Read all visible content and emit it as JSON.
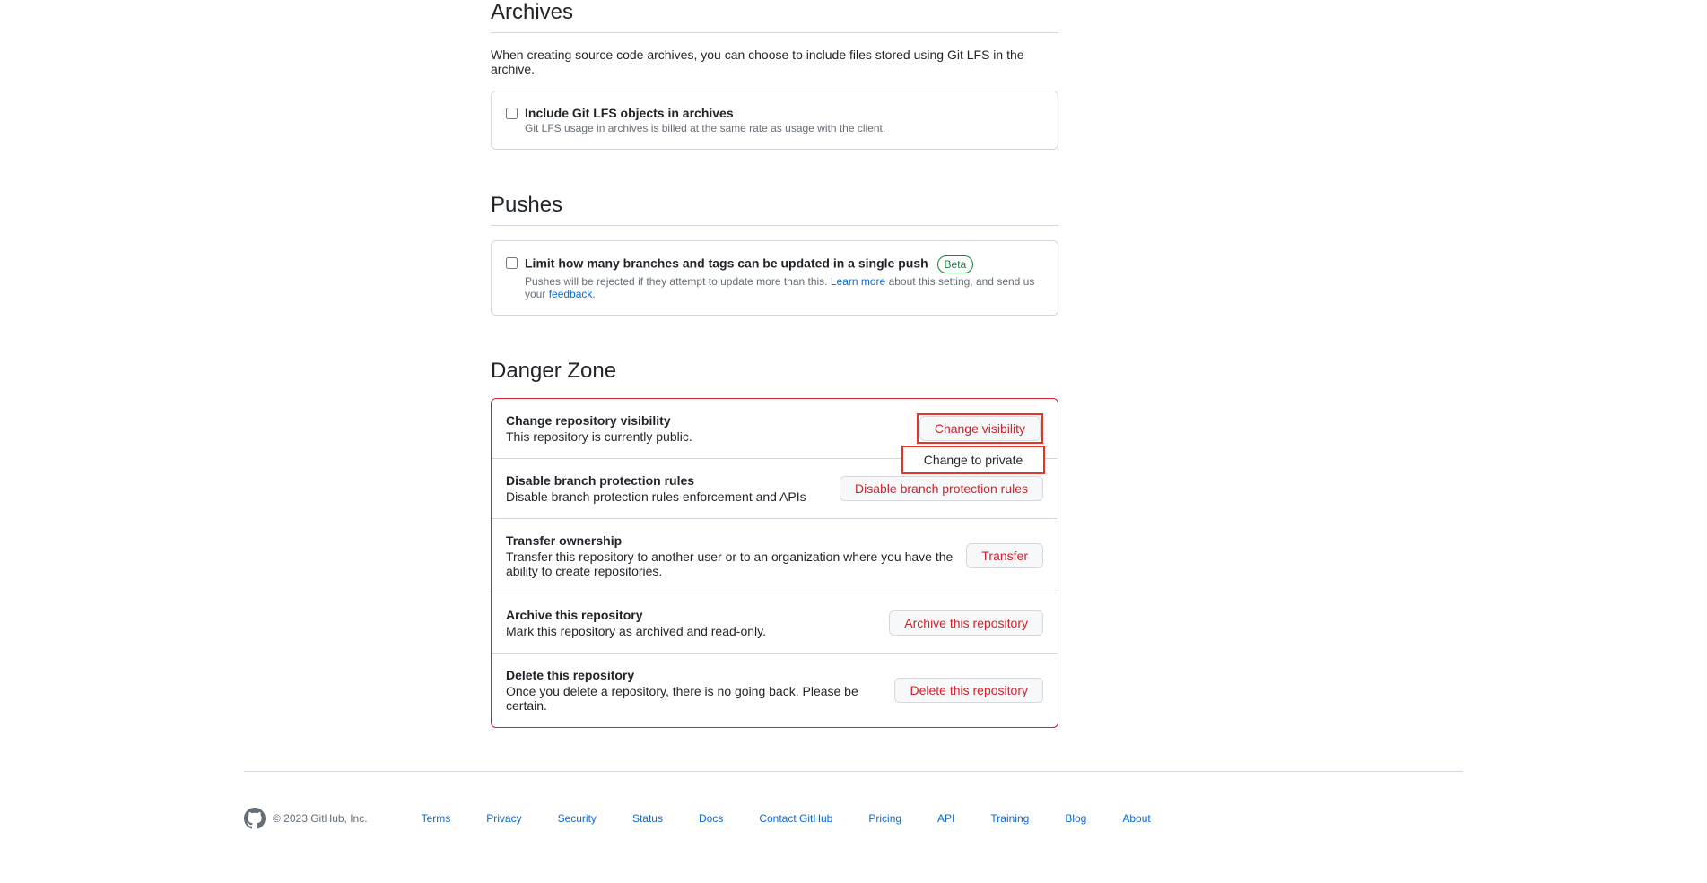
{
  "archives": {
    "heading": "Archives",
    "desc": "When creating source code archives, you can choose to include files stored using Git LFS in the archive.",
    "checkbox_label": "Include Git LFS objects in archives",
    "checkbox_hint": "Git LFS usage in archives is billed at the same rate as usage with the client."
  },
  "pushes": {
    "heading": "Pushes",
    "checkbox_label": "Limit how many branches and tags can be updated in a single push",
    "beta": "Beta",
    "hint_pre": "Pushes will be rejected if they attempt to update more than this. ",
    "learn_more": "Learn more",
    "hint_mid": " about this setting, and send us your ",
    "feedback": "feedback",
    "hint_end": "."
  },
  "danger": {
    "heading": "Danger Zone",
    "visibility": {
      "title": "Change repository visibility",
      "desc": "This repository is currently public.",
      "button": "Change visibility",
      "dropdown": "Change to private"
    },
    "branch_rules": {
      "title": "Disable branch protection rules",
      "desc": "Disable branch protection rules enforcement and APIs",
      "button": "Disable branch protection rules"
    },
    "transfer": {
      "title": "Transfer ownership",
      "desc": "Transfer this repository to another user or to an organization where you have the ability to create repositories.",
      "button": "Transfer"
    },
    "archive": {
      "title": "Archive this repository",
      "desc": "Mark this repository as archived and read-only.",
      "button": "Archive this repository"
    },
    "delete": {
      "title": "Delete this repository",
      "desc": "Once you delete a repository, there is no going back. Please be certain.",
      "button": "Delete this repository"
    }
  },
  "footer": {
    "copyright": "© 2023 GitHub, Inc.",
    "links": [
      "Terms",
      "Privacy",
      "Security",
      "Status",
      "Docs",
      "Contact GitHub",
      "Pricing",
      "API",
      "Training",
      "Blog",
      "About"
    ]
  }
}
